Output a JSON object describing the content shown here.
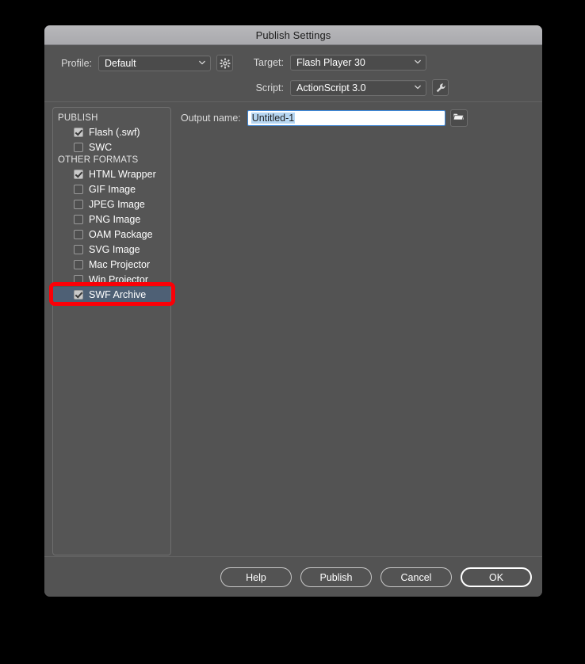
{
  "window": {
    "title": "Publish Settings"
  },
  "header": {
    "profile": {
      "label": "Profile:",
      "value": "Default",
      "gear_icon": "gear-icon"
    },
    "target": {
      "label": "Target:",
      "value": "Flash Player 30"
    },
    "script": {
      "label": "Script:",
      "value": "ActionScript 3.0",
      "wrench_icon": "wrench-icon"
    }
  },
  "format_list": {
    "groups": [
      {
        "label": "PUBLISH",
        "items": [
          {
            "label": "Flash (.swf)",
            "checked": true,
            "selected": false
          },
          {
            "label": "SWC",
            "checked": false,
            "selected": false
          }
        ]
      },
      {
        "label": "OTHER FORMATS",
        "items": [
          {
            "label": "HTML Wrapper",
            "checked": true,
            "selected": false
          },
          {
            "label": "GIF Image",
            "checked": false,
            "selected": false
          },
          {
            "label": "JPEG Image",
            "checked": false,
            "selected": false
          },
          {
            "label": "PNG Image",
            "checked": false,
            "selected": false
          },
          {
            "label": "OAM Package",
            "checked": false,
            "selected": false
          },
          {
            "label": "SVG Image",
            "checked": false,
            "selected": false
          },
          {
            "label": "Mac Projector",
            "checked": false,
            "selected": false
          },
          {
            "label": "Win Projector",
            "checked": false,
            "selected": false
          },
          {
            "label": "SWF Archive",
            "checked": true,
            "selected": true
          }
        ]
      }
    ]
  },
  "main": {
    "output": {
      "label": "Output name:",
      "value": "Untitled-1",
      "placeholder": "Untitled-1",
      "browse_icon": "folder-icon"
    }
  },
  "footer": {
    "buttons": [
      {
        "label": "Help",
        "default": false
      },
      {
        "label": "Publish",
        "default": false
      },
      {
        "label": "Cancel",
        "default": false
      },
      {
        "label": "OK",
        "default": true
      }
    ]
  },
  "annotation": {
    "color": "#fb0007",
    "target": "SWF Archive"
  },
  "colors": {
    "dialog_bg": "#535353",
    "titlebar": "#b0b0b3",
    "selection_blue": "#4e6075",
    "field_border_blue": "#3f86d4",
    "text_selection": "#b6d6f2",
    "annotation_red": "#fb0007"
  }
}
